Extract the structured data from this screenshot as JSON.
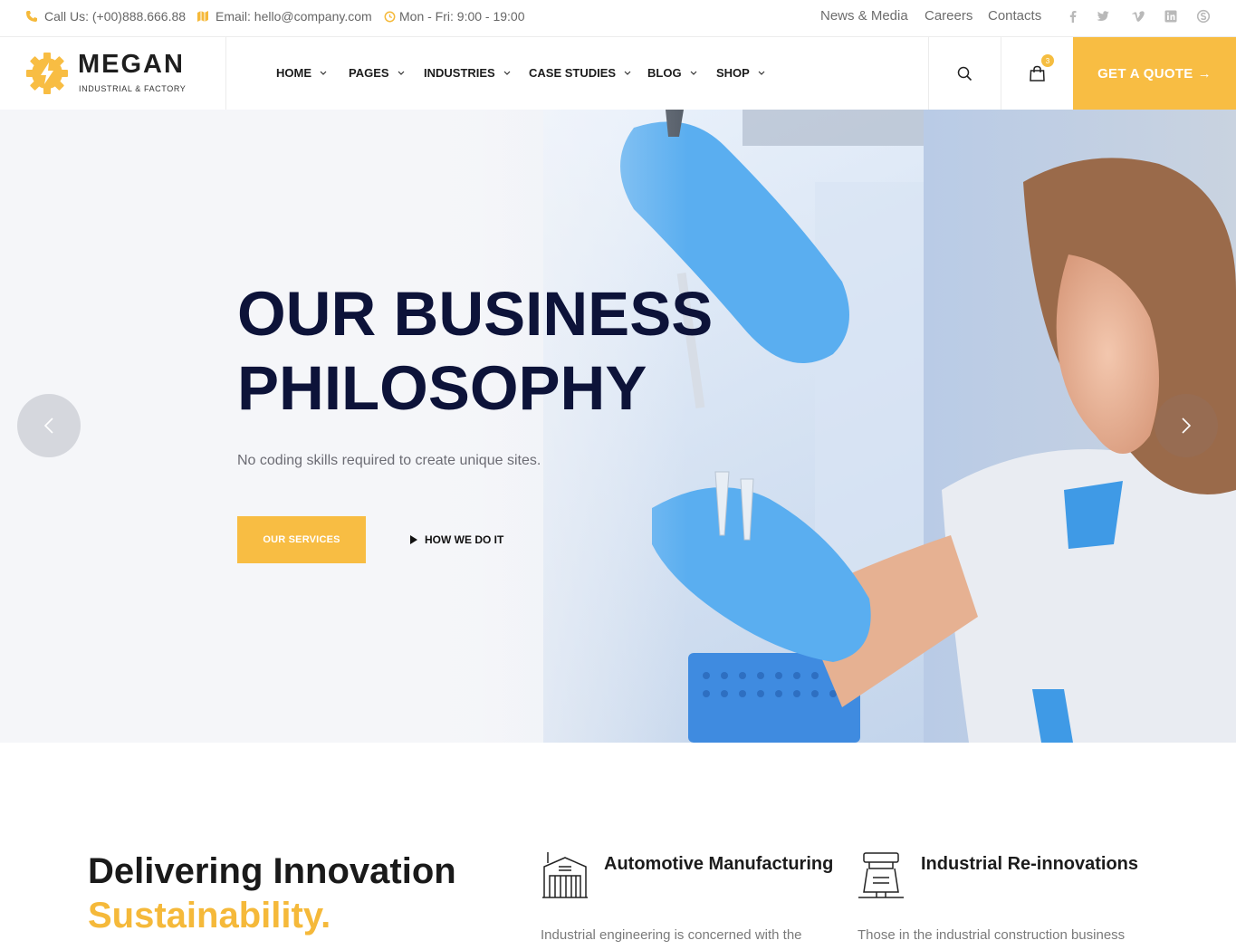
{
  "topbar": {
    "phone": "Call Us: (+00)888.666.88",
    "email": "Email: hello@company.com",
    "hours": "Mon - Fri: 9:00 - 19:00",
    "links": [
      "News & Media",
      "Careers",
      "Contacts"
    ],
    "social_icons": [
      "facebook-icon",
      "twitter-icon",
      "vimeo-icon",
      "linkedin-icon",
      "skype-icon"
    ]
  },
  "header": {
    "logo_name": "MEGAN",
    "logo_tag": "INDUSTRIAL & FACTORY",
    "nav": [
      "HOME",
      "PAGES",
      "INDUSTRIES",
      "CASE STUDIES",
      "BLOG",
      "SHOP"
    ],
    "cart_count": "3",
    "quote_label": "GET A QUOTE",
    "quote_arrow": "→"
  },
  "hero": {
    "title_line1": "OUR BUSINESS",
    "title_line2": "PHILOSOPHY",
    "subtitle": "No coding skills required to create unique sites.",
    "primary_button": "OUR SERVICES",
    "secondary_button": "HOW WE DO IT"
  },
  "section": {
    "title": "Delivering Innovation",
    "highlight": "Sustainability.",
    "features": [
      {
        "title": "Automotive Manufacturing",
        "text": "Industrial engineering is concerned with the"
      },
      {
        "title": "Industrial Re-innovations",
        "text": "Those in the industrial construction business"
      }
    ]
  },
  "colors": {
    "accent": "#f8bd43",
    "navy": "#0d1339",
    "text_muted": "#6c6c74"
  }
}
